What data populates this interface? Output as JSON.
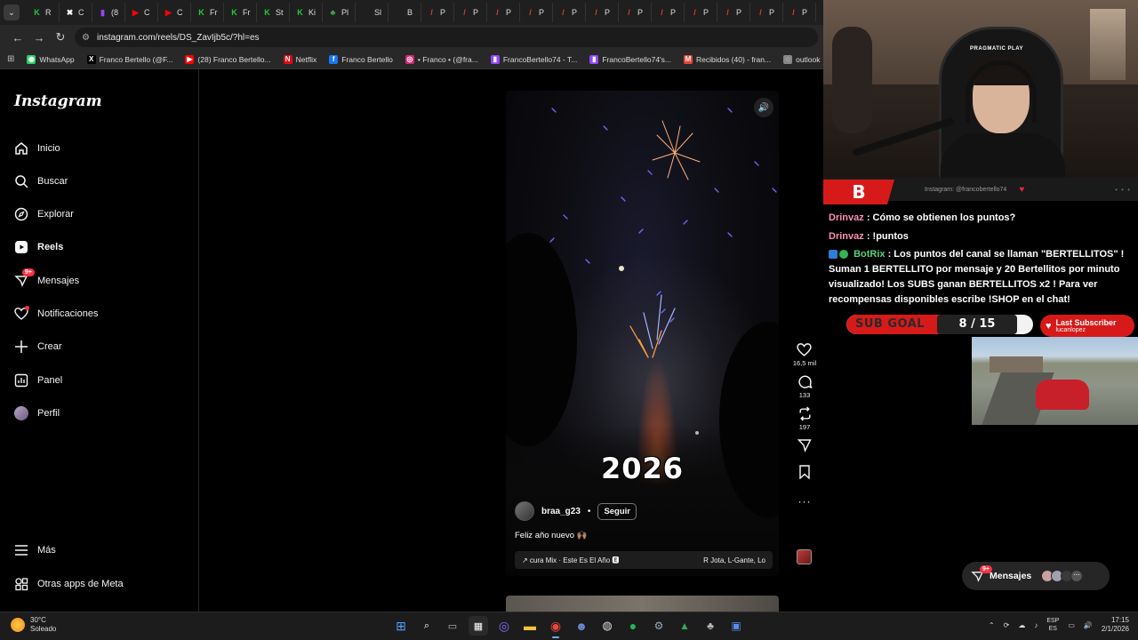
{
  "browser": {
    "tabs": [
      {
        "label": "R",
        "color": "#25c93b",
        "glyph": "K"
      },
      {
        "label": "C",
        "color": "#ffffff",
        "glyph": "✖"
      },
      {
        "label": "(8",
        "color": "#9146ff",
        "glyph": "▮"
      },
      {
        "label": "C",
        "color": "#ff0000",
        "glyph": "▶"
      },
      {
        "label": "C",
        "color": "#ff0000",
        "glyph": "▶"
      },
      {
        "label": "Fr",
        "color": "#25c93b",
        "glyph": "K"
      },
      {
        "label": "Fr",
        "color": "#25c93b",
        "glyph": "K"
      },
      {
        "label": "St",
        "color": "#25c93b",
        "glyph": "K"
      },
      {
        "label": "Ki",
        "color": "#25c93b",
        "glyph": "K"
      },
      {
        "label": "Pl",
        "color": "#3ab54a",
        "glyph": "♣"
      },
      {
        "label": "Sl",
        "color": "#888888",
        "glyph": ""
      },
      {
        "label": "B",
        "color": "#888888",
        "glyph": ""
      },
      {
        "label": "P",
        "color": "#e23b3b",
        "glyph": "/"
      },
      {
        "label": "P",
        "color": "#e23b3b",
        "glyph": "/"
      },
      {
        "label": "P",
        "color": "#e23b3b",
        "glyph": "/"
      },
      {
        "label": "P",
        "color": "#e23b3b",
        "glyph": "/"
      },
      {
        "label": "P",
        "color": "#e23b3b",
        "glyph": "/"
      },
      {
        "label": "P",
        "color": "#e23b3b",
        "glyph": "/"
      },
      {
        "label": "P",
        "color": "#e23b3b",
        "glyph": "/"
      },
      {
        "label": "P",
        "color": "#e23b3b",
        "glyph": "/"
      },
      {
        "label": "P",
        "color": "#e23b3b",
        "glyph": "/"
      },
      {
        "label": "P",
        "color": "#e23b3b",
        "glyph": "/"
      },
      {
        "label": "P",
        "color": "#e23b3b",
        "glyph": "/"
      },
      {
        "label": "P",
        "color": "#e23b3b",
        "glyph": "/"
      },
      {
        "label": "P",
        "color": "#e23b3b",
        "glyph": "/"
      },
      {
        "label": "P",
        "color": "#e23b3b",
        "glyph": "/"
      }
    ],
    "url": "instagram.com/reels/DS_ZavIjb5c/?hl=es",
    "bookmarks": [
      {
        "label": "WhatsApp",
        "color": "#25d366",
        "glyph": "◉"
      },
      {
        "label": "Franco Bertello (@F...",
        "color": "#000000",
        "glyph": "X"
      },
      {
        "label": "(28) Franco Bertello...",
        "color": "#ff0000",
        "glyph": "▶"
      },
      {
        "label": "Netflix",
        "color": "#e50914",
        "glyph": "N"
      },
      {
        "label": "Franco Bertello",
        "color": "#1877f2",
        "glyph": "f"
      },
      {
        "label": "• Franco • (@fra...",
        "color": "#d62976",
        "glyph": "◎"
      },
      {
        "label": "FrancoBertello74 - T...",
        "color": "#9146ff",
        "glyph": "▮"
      },
      {
        "label": "FrancoBertello74's...",
        "color": "#9146ff",
        "glyph": "▮"
      },
      {
        "label": "Recibidos (40) - fran...",
        "color": "#ea4335",
        "glyph": "M"
      },
      {
        "label": "outlook",
        "color": "#888888",
        "glyph": "◌"
      },
      {
        "label": "Aler",
        "color": "#2bb673",
        "glyph": "▣"
      }
    ]
  },
  "instagram": {
    "logo": "Instagram",
    "nav": [
      {
        "label": "Inicio",
        "icon": "home-icon"
      },
      {
        "label": "Buscar",
        "icon": "search-icon"
      },
      {
        "label": "Explorar",
        "icon": "compass-icon"
      },
      {
        "label": "Reels",
        "icon": "reels-icon"
      },
      {
        "label": "Mensajes",
        "icon": "messenger-icon",
        "badge": "9+"
      },
      {
        "label": "Notificaciones",
        "icon": "heart-icon",
        "dot": true
      },
      {
        "label": "Crear",
        "icon": "plus-icon"
      },
      {
        "label": "Panel",
        "icon": "chart-icon"
      },
      {
        "label": "Perfil",
        "icon": "avatar-icon"
      }
    ],
    "more": "Más",
    "meta_apps": "Otras apps de Meta",
    "reel": {
      "year_overlay": "2026",
      "username": "braa_g23",
      "separator": "•",
      "follow": "Seguir",
      "caption": "Feliz año nuevo 🙌🏽",
      "audio_title": "↗ cura Mix · Este Es El Año 🅴",
      "audio_artists": "R Jota, L-Gante, Lo",
      "likes": "16,5 mil",
      "comments": "133",
      "reposts": "197"
    },
    "messages_pill": {
      "label": "Mensajes",
      "badge": "9+"
    }
  },
  "stream": {
    "logo_letter": "B",
    "handle": "Instagram: @francobertello74",
    "chat": [
      {
        "user": "Drinvaz",
        "text": ": Cómo se obtienen los puntos?"
      },
      {
        "user": "Drinvaz",
        "text": ": !puntos"
      },
      {
        "user": "BotRix",
        "text": ": Los puntos del canal se llaman \"BERTELLITOS\" ! Suman 1 BERTELLITO por mensaje y 20 Bertellitos por minuto visualizado! Los SUBS ganan BERTELLITOS x2 ! Para ver recompensas disponibles escribe !SHOP en el chat!"
      }
    ],
    "sub_goal": {
      "label": "SUB GOAL",
      "current": 8,
      "target": 15,
      "display": "8 / 15"
    },
    "last_subscriber": {
      "title": "Last Subscriber",
      "name": "lucanlopez"
    },
    "chair_brand": "PRAGMATIC PLAY"
  },
  "taskbar": {
    "weather_temp": "30°C",
    "weather_desc": "Soleado",
    "lang_1": "ESP",
    "lang_2": "ES",
    "time": "17:15",
    "date": "2/1/2026"
  }
}
